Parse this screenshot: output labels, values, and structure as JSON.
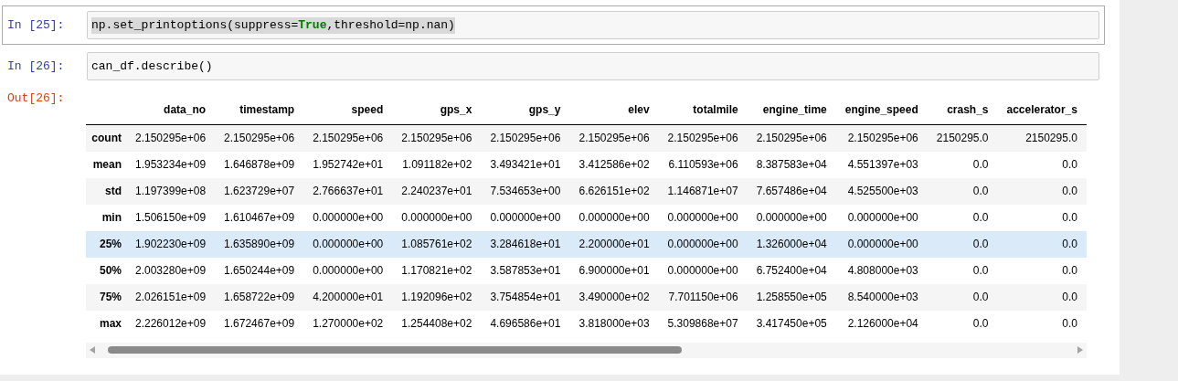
{
  "cells": [
    {
      "prompt": "In [25]:",
      "selected": true,
      "text_highlighted": true,
      "code": [
        {
          "text": "np.set_printoptions(suppress=",
          "kind": "plain"
        },
        {
          "text": "True",
          "kind": "keyword"
        },
        {
          "text": ",threshold=np.nan)",
          "kind": "plain"
        }
      ]
    },
    {
      "prompt": "In [26]:",
      "selected": false,
      "text_highlighted": false,
      "code": [
        {
          "text": "can_df.describe()",
          "kind": "plain"
        }
      ]
    }
  ],
  "output": {
    "prompt": "Out[26]:",
    "table": {
      "columns": [
        "data_no",
        "timestamp",
        "speed",
        "gps_x",
        "gps_y",
        "elev",
        "totalmile",
        "engine_time",
        "engine_speed",
        "crash_s",
        "accelerator_s"
      ],
      "rows": [
        {
          "label": "count",
          "hovered": false,
          "cells": [
            "2.150295e+06",
            "2.150295e+06",
            "2.150295e+06",
            "2.150295e+06",
            "2.150295e+06",
            "2.150295e+06",
            "2.150295e+06",
            "2.150295e+06",
            "2.150295e+06",
            "2150295.0",
            "2150295.0"
          ]
        },
        {
          "label": "mean",
          "hovered": false,
          "cells": [
            "1.953234e+09",
            "1.646878e+09",
            "1.952742e+01",
            "1.091182e+02",
            "3.493421e+01",
            "3.412586e+02",
            "6.110593e+06",
            "8.387583e+04",
            "4.551397e+03",
            "0.0",
            "0.0"
          ]
        },
        {
          "label": "std",
          "hovered": false,
          "cells": [
            "1.197399e+08",
            "1.623729e+07",
            "2.766637e+01",
            "2.240237e+01",
            "7.534653e+00",
            "6.626151e+02",
            "1.146871e+07",
            "7.657486e+04",
            "4.525500e+03",
            "0.0",
            "0.0"
          ]
        },
        {
          "label": "min",
          "hovered": false,
          "cells": [
            "1.506150e+09",
            "1.610467e+09",
            "0.000000e+00",
            "0.000000e+00",
            "0.000000e+00",
            "0.000000e+00",
            "0.000000e+00",
            "0.000000e+00",
            "0.000000e+00",
            "0.0",
            "0.0"
          ]
        },
        {
          "label": "25%",
          "hovered": true,
          "cells": [
            "1.902230e+09",
            "1.635890e+09",
            "0.000000e+00",
            "1.085761e+02",
            "3.284618e+01",
            "2.200000e+01",
            "0.000000e+00",
            "1.326000e+04",
            "0.000000e+00",
            "0.0",
            "0.0"
          ]
        },
        {
          "label": "50%",
          "hovered": false,
          "cells": [
            "2.003280e+09",
            "1.650244e+09",
            "0.000000e+00",
            "1.170821e+02",
            "3.587853e+01",
            "6.900000e+01",
            "0.000000e+00",
            "6.752400e+04",
            "4.808000e+03",
            "0.0",
            "0.0"
          ]
        },
        {
          "label": "75%",
          "hovered": false,
          "cells": [
            "2.026151e+09",
            "1.658722e+09",
            "4.200000e+01",
            "1.192096e+02",
            "3.754854e+01",
            "3.490000e+02",
            "7.701150e+06",
            "1.258550e+05",
            "8.540000e+03",
            "0.0",
            "0.0"
          ]
        },
        {
          "label": "max",
          "hovered": false,
          "cells": [
            "2.226012e+09",
            "1.672467e+09",
            "1.270000e+02",
            "1.254408e+02",
            "4.696586e+01",
            "3.818000e+03",
            "5.309868e+07",
            "3.417450e+05",
            "2.126000e+04",
            "0.0",
            "0.0"
          ]
        }
      ]
    }
  }
}
